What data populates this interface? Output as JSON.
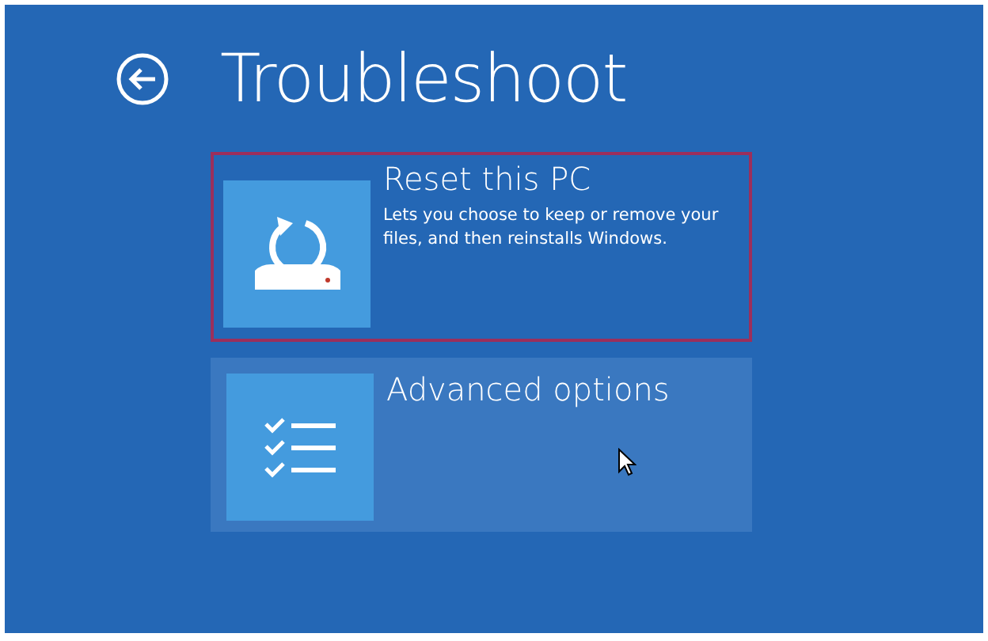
{
  "title": "Troubleshoot",
  "options": [
    {
      "kind": "reset",
      "title": "Reset this PC",
      "description": "Lets you choose to keep or remove your files, and then reinstalls Windows.",
      "outlined": true,
      "hovered": false
    },
    {
      "kind": "advanced",
      "title": "Advanced options",
      "outlined": false,
      "hovered": true
    }
  ]
}
